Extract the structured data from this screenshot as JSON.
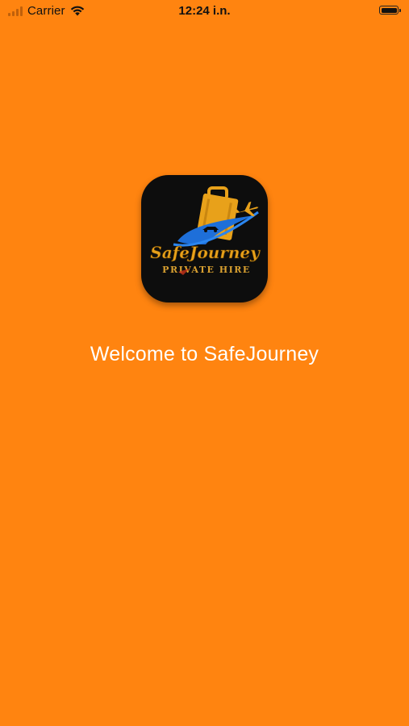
{
  "status_bar": {
    "carrier": "Carrier",
    "time": "12:24 i.n.",
    "signal_icon": "cellular-signal-icon",
    "wifi_icon": "wifi-icon",
    "battery_icon": "battery-icon",
    "battery_level": 1.0
  },
  "splash": {
    "logo_brand": "SafeJourney",
    "logo_subtitle": "PRIVATE HIRE",
    "welcome_text": "Welcome to SafeJourney"
  },
  "colors": {
    "background": "#FF8410",
    "icon_background": "#0D0D0D",
    "welcome_text": "#FFFFFF",
    "logo_blue": "#1E6FD9",
    "logo_gold": "#E8A11A"
  }
}
